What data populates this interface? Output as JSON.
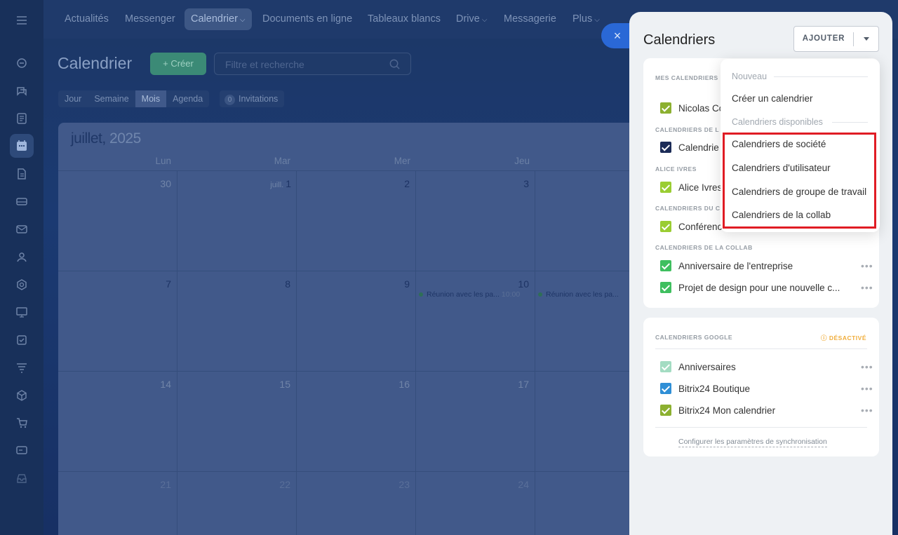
{
  "topnav": {
    "items": [
      "Actualités",
      "Messenger",
      "Calendrier",
      "Documents en ligne",
      "Tableaux blancs",
      "Drive",
      "Messagerie",
      "Plus"
    ],
    "active": "Calendrier"
  },
  "page": {
    "title": "Calendrier",
    "create_label": "+ Créer",
    "search_placeholder": "Filtre et recherche",
    "view_tabs": [
      "Jour",
      "Semaine",
      "Mois",
      "Agenda"
    ],
    "active_view": "Mois",
    "invitations_count": "0",
    "invitations_label": "Invitations"
  },
  "calendar": {
    "month": "juillet,",
    "year": "2025",
    "weekdays": [
      "Lun",
      "Mar",
      "Mer",
      "Jeu"
    ],
    "weeks": [
      [
        "30",
        "1",
        "2",
        "3"
      ],
      [
        "7",
        "8",
        "9",
        "10"
      ],
      [
        "14",
        "15",
        "16",
        "17"
      ],
      [
        "21",
        "22",
        "23",
        "24"
      ]
    ],
    "month_prefix": "juill.",
    "events": [
      {
        "label": "Réunion avec les pa...",
        "time": "10:00"
      },
      {
        "label": "Réunion avec les pa..."
      }
    ]
  },
  "panel": {
    "close_symbol": "×",
    "title": "Calendriers",
    "add_label": "AJOUTER",
    "sections": [
      {
        "label": "MES CALENDRIERS",
        "items": [
          {
            "name": "Nicolas Co",
            "color": "#8cb030"
          }
        ]
      },
      {
        "label": "CALENDRIERS DE L",
        "items": [
          {
            "name": "Calendrie",
            "color": "#1b2b57"
          }
        ]
      },
      {
        "label": "ALICE IVRES",
        "items": [
          {
            "name": "Alice Ivres",
            "color": "#9acd32"
          }
        ]
      },
      {
        "label": "CALENDRIERS DU C",
        "items": [
          {
            "name": "Conférenc",
            "color": "#9acd32"
          }
        ]
      },
      {
        "label": "CALENDRIERS DE LA COLLAB",
        "items": [
          {
            "name": "Anniversaire de l'entreprise",
            "color": "#3fbf5f"
          },
          {
            "name": "Projet de design pour une nouvelle c...",
            "color": "#3fbf5f"
          }
        ]
      }
    ],
    "google": {
      "label": "CALENDRIERS GOOGLE",
      "status": "ⓘ DÉSACTIVÉ",
      "items": [
        {
          "name": "Anniversaires",
          "color": "#a3dcc2"
        },
        {
          "name": "Bitrix24 Boutique",
          "color": "#2f8fd6"
        },
        {
          "name": "Bitrix24 Mon calendrier",
          "color": "#8cb030"
        }
      ],
      "sync_link": "Configurer les paramètres de synchronisation"
    },
    "more_symbol": "•••"
  },
  "dropdown": {
    "new_header": "Nouveau",
    "create_item": "Créer un calendrier",
    "available_header": "Calendriers disponibles",
    "items": [
      "Calendriers de société",
      "Calendriers d'utilisateur",
      "Calendriers de groupe de travail",
      "Calendriers de la collab"
    ]
  }
}
